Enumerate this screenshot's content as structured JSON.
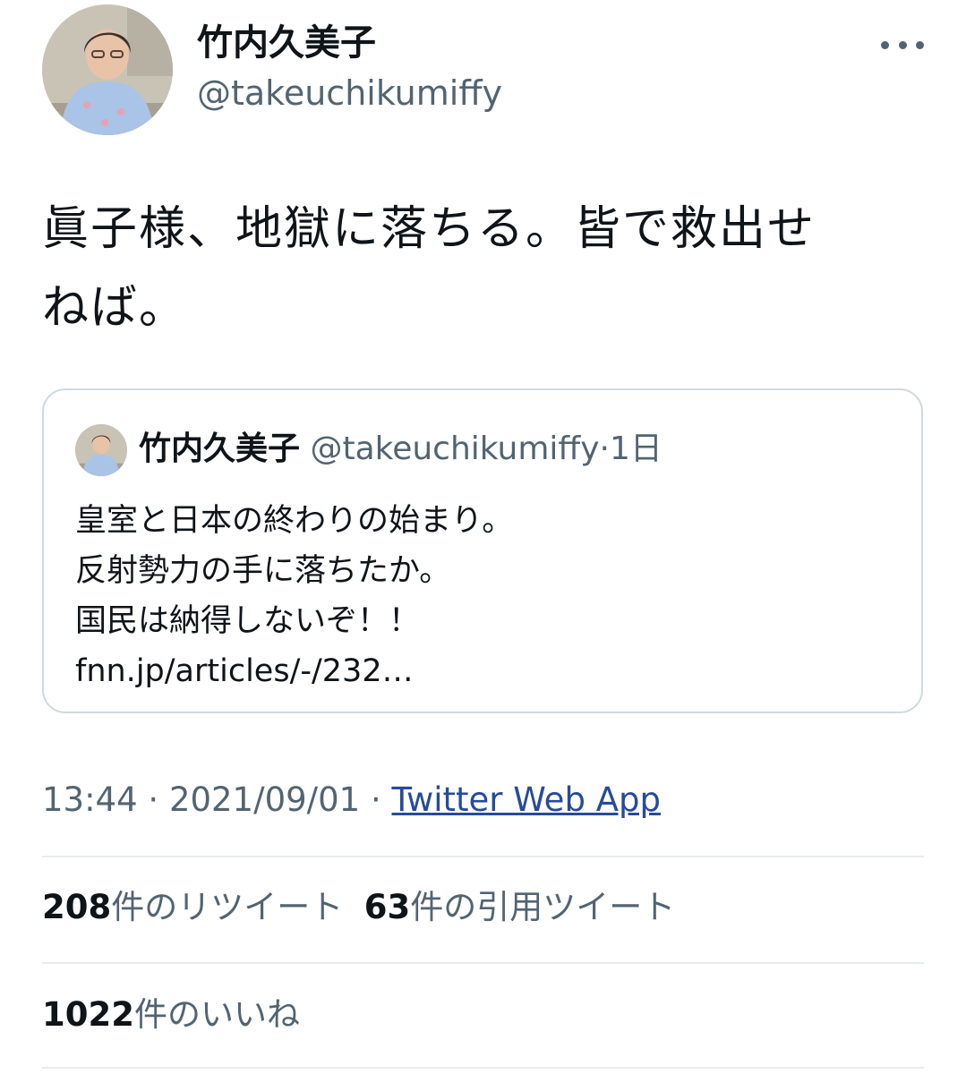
{
  "author": {
    "display_name": "竹内久美子",
    "handle": "@takeuchikumiffy",
    "avatar_icon": "profile-photo"
  },
  "more_icon": "more-options-icon",
  "tweet": {
    "text_lines": [
      "眞子様、地獄に落ちる。皆で救出せ",
      "ねば。"
    ]
  },
  "quoted_tweet": {
    "display_name": "竹内久美子",
    "handle": "@takeuchikumiffy",
    "separator": "·",
    "time": "1日",
    "text_lines": [
      "皇室と日本の終わりの始まり。",
      "反射勢力の手に落ちたか。",
      "国民は納得しないぞ！！",
      "fnn.jp/articles/-/232…"
    ]
  },
  "meta": {
    "time": "13:44",
    "date": "2021/09/01",
    "separator": "·",
    "source": "Twitter Web App"
  },
  "stats": {
    "retweets_count": "208",
    "retweets_label": "件のリツイート",
    "quotes_count": "63",
    "quotes_label": "件の引用ツイート",
    "likes_count": "1022",
    "likes_label": "件のいいね"
  },
  "colors": {
    "text": "#0f1419",
    "secondary": "#536471",
    "link": "#274b9a",
    "border": "#cfd9de"
  }
}
